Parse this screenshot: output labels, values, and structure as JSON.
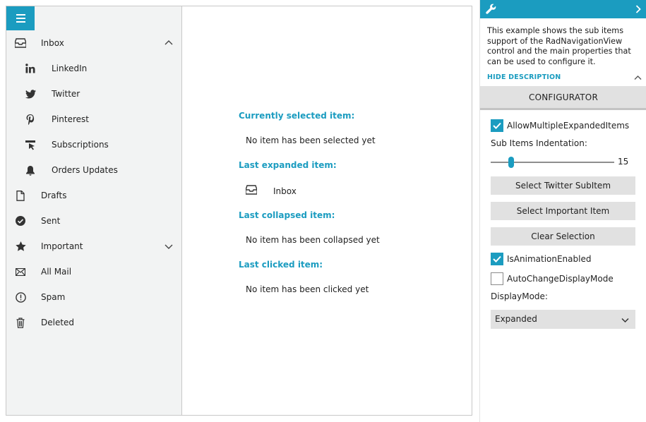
{
  "nav": {
    "items": [
      {
        "label": "Inbox",
        "icon": "inbox-icon",
        "expanded": true
      },
      {
        "label": "LinkedIn",
        "icon": "linkedin-icon"
      },
      {
        "label": "Twitter",
        "icon": "twitter-icon"
      },
      {
        "label": "Pinterest",
        "icon": "pinterest-icon"
      },
      {
        "label": "Subscriptions",
        "icon": "subscriptions-icon"
      },
      {
        "label": "Orders Updates",
        "icon": "bell-icon"
      },
      {
        "label": "Drafts",
        "icon": "document-icon"
      },
      {
        "label": "Sent",
        "icon": "checkmark-circle-icon"
      },
      {
        "label": "Important",
        "icon": "star-icon",
        "expanded": false
      },
      {
        "label": "All Mail",
        "icon": "envelope-icon"
      },
      {
        "label": "Spam",
        "icon": "exclamation-circle-icon"
      },
      {
        "label": "Deleted",
        "icon": "trash-icon"
      }
    ]
  },
  "content": {
    "selected_title": "Currently selected item:",
    "selected_value": "No item has been selected yet",
    "expanded_title": "Last expanded item:",
    "expanded_value": "Inbox",
    "collapsed_title": "Last collapsed item:",
    "collapsed_value": "No item has been collapsed yet",
    "clicked_title": "Last clicked item:",
    "clicked_value": "No item has been clicked yet"
  },
  "panel": {
    "description": "This example shows the sub items support of the RadNavigationView control and the main properties that can be used to configure it.",
    "hide_description": "HIDE DESCRIPTION",
    "configurator": "CONFIGURATOR",
    "allow_multiple": {
      "label": "AllowMultipleExpandedItems",
      "checked": true
    },
    "indentation_label": "Sub Items Indentation:",
    "indentation_value": "15",
    "indentation_fraction": 0.15,
    "btn_twitter": "Select Twitter SubItem",
    "btn_important": "Select Important Item",
    "btn_clear": "Clear Selection",
    "animation": {
      "label": "IsAnimationEnabled",
      "checked": true
    },
    "auto_change": {
      "label": "AutoChangeDisplayMode",
      "checked": false
    },
    "display_mode_label": "DisplayMode:",
    "display_mode_value": "Expanded"
  },
  "colors": {
    "accent": "#1b9cc0",
    "nav_background": "#f2f3f3",
    "button_background": "#e1e1e1"
  }
}
